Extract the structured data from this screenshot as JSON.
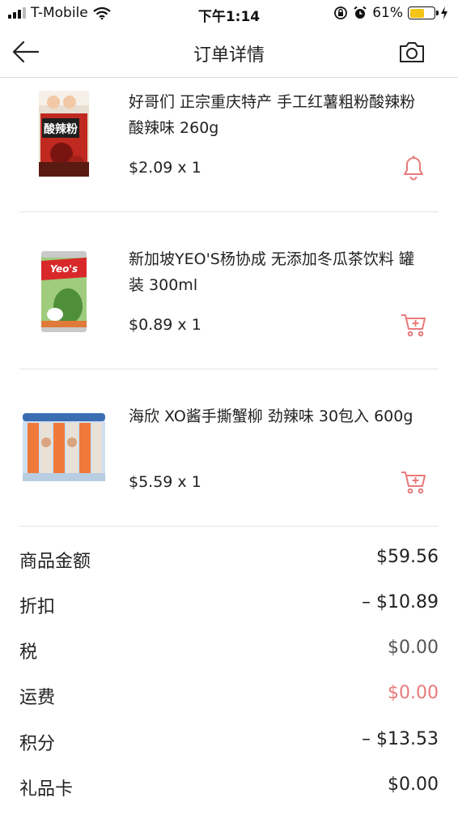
{
  "status_bar": {
    "carrier": "T-Mobile",
    "time": "下午1:14",
    "battery_percent": "61%",
    "battery_level": 0.61
  },
  "nav": {
    "title": "订单详情"
  },
  "products": [
    {
      "name": "好哥们 正宗重庆特产 手工红薯粗粉酸辣粉 酸辣味 260g",
      "price": "$2.09 x 1",
      "image_label": "酸辣粉",
      "action_icon": "bell-icon"
    },
    {
      "name": "新加坡YEO'S杨协成 无添加冬瓜茶饮料 罐装 300ml",
      "price": "$0.89 x 1",
      "image_label": "Yeo's",
      "action_icon": "add-to-cart-icon"
    },
    {
      "name": "海欣 XO酱手撕蟹柳 劲辣味 30包入 600g",
      "price": "$5.59 x 1",
      "image_label": "",
      "action_icon": "add-to-cart-icon"
    }
  ],
  "summary": [
    {
      "label": "商品金额",
      "value": "$59.56"
    },
    {
      "label": "折扣",
      "value": "– $10.89"
    },
    {
      "label": "税",
      "value": "$0.00"
    },
    {
      "label": "运费",
      "value": "$0.00"
    },
    {
      "label": "积分",
      "value": "– $13.53"
    },
    {
      "label": "礼品卡",
      "value": "$0.00"
    }
  ],
  "colors": {
    "accent_red": "#e87a7a",
    "divider": "#e4e4e4",
    "battery": "#f5c419"
  }
}
